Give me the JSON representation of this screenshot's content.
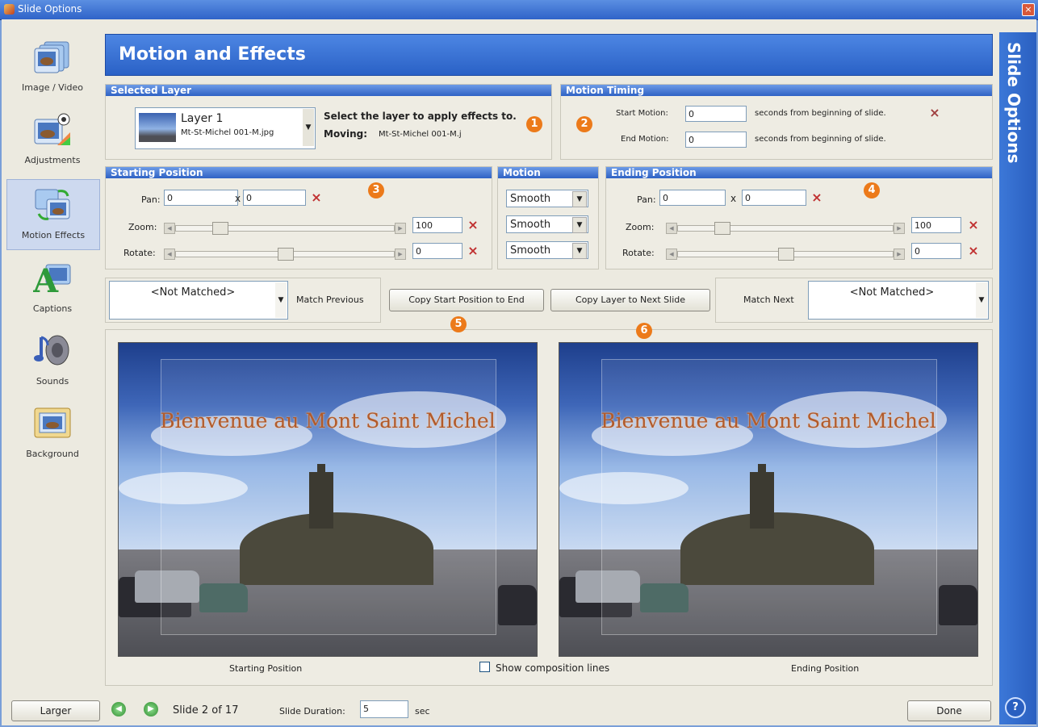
{
  "window": {
    "title": "Slide Options",
    "close_label": "×"
  },
  "sidebar": {
    "items": [
      {
        "label": "Image / Video",
        "icon": "image-video-icon"
      },
      {
        "label": "Adjustments",
        "icon": "adjustments-icon"
      },
      {
        "label": "Motion Effects",
        "icon": "motion-effects-icon",
        "selected": true
      },
      {
        "label": "Captions",
        "icon": "captions-icon"
      },
      {
        "label": "Sounds",
        "icon": "sounds-icon"
      },
      {
        "label": "Background",
        "icon": "background-icon"
      }
    ]
  },
  "rightbar": {
    "title": "Slide Options",
    "help": "?"
  },
  "header": {
    "title": "Motion and Effects"
  },
  "selected_layer": {
    "group_title": "Selected Layer",
    "layer_name": "Layer  1",
    "layer_file": "Mt-St-Michel 001-M.jpg",
    "instruction": "Select the layer to apply effects to.",
    "moving_label": "Moving:",
    "moving_value": "Mt-St-Michel 001-M.j"
  },
  "motion_timing": {
    "group_title": "Motion Timing",
    "start_label": "Start Motion:",
    "start_value": "0",
    "end_label": "End Motion:",
    "end_value": "0",
    "suffix": "seconds from beginning of slide.",
    "suffix_end": "seconds from beginning of slide."
  },
  "starting_position": {
    "group_title": "Starting Position",
    "pan_label": "Pan:",
    "pan_x": "0",
    "pan_sep": "x",
    "pan_y": "0",
    "zoom_label": "Zoom:",
    "zoom_value": "100",
    "rotate_label": "Rotate:",
    "rotate_value": "0"
  },
  "motion": {
    "group_title": "Motion",
    "pan": "Smooth",
    "zoom": "Smooth",
    "rotate": "Smooth"
  },
  "ending_position": {
    "group_title": "Ending Position",
    "pan_label": "Pan:",
    "pan_x": "0",
    "pan_sep": "x",
    "pan_y": "0",
    "zoom_label": "Zoom:",
    "zoom_value": "100",
    "rotate_label": "Rotate:",
    "rotate_value": "0"
  },
  "match": {
    "previous_value": "<Not Matched>",
    "previous_label": "Match Previous",
    "copy_start_label": "Copy Start Position to End",
    "copy_layer_label": "Copy Layer to Next Slide",
    "next_label": "Match Next",
    "next_value": "<Not Matched>"
  },
  "badges": [
    "1",
    "2",
    "3",
    "4",
    "5",
    "6"
  ],
  "preview": {
    "photo_title": "Bienvenue au Mont Saint Michel",
    "start_label": "Starting Position",
    "end_label": "Ending Position",
    "composition_label": "Show composition lines",
    "composition_checked": false
  },
  "footer": {
    "larger_label": "Larger",
    "slide_text": "Slide 2 of 17",
    "duration_label": "Slide Duration:",
    "duration_value": "5",
    "duration_unit": "sec",
    "done_label": "Done"
  },
  "colors": {
    "accent": "#2a61c6",
    "badge": "#ec7a1a",
    "clear_x": "#c03030"
  }
}
